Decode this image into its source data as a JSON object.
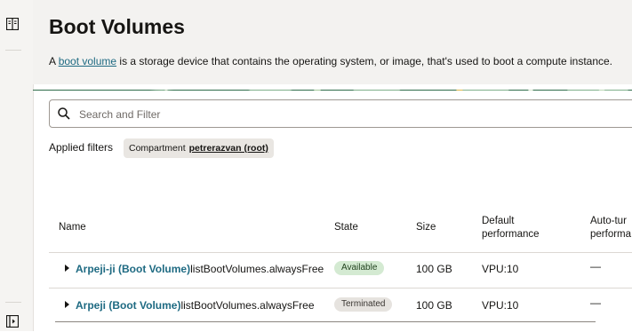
{
  "rail": {
    "top_icon": "panel-icon",
    "bottom_icon": "expand-panel-icon"
  },
  "page": {
    "title": "Boot Volumes",
    "desc_prefix": "A ",
    "desc_link": "boot volume",
    "desc_suffix": " is a storage device that contains the operating system, or image, that's used to boot a compute instance."
  },
  "search": {
    "placeholder": "Search and Filter",
    "value": ""
  },
  "filters": {
    "label": "Applied filters",
    "chip_key": "Compartment",
    "chip_value": "petrerazvan (root)"
  },
  "table": {
    "columns": {
      "name": "Name",
      "state": "State",
      "size": "Size",
      "default_perf_1": "Default",
      "default_perf_2": "performance",
      "autotune_1": "Auto-tur",
      "autotune_2": "performa"
    },
    "rows": [
      {
        "name_link": "Arpeji-ji (Boot Volume)",
        "name_suffix": "listBootVolumes.alwaysFree",
        "state": "Available",
        "size": "100 GB",
        "performance": "VPU:10",
        "autotune": "—"
      },
      {
        "name_link": "Arpeji (Boot Volume)",
        "name_suffix": "listBootVolumes.alwaysFree",
        "state": "Terminated",
        "size": "100 GB",
        "performance": "VPU:10",
        "autotune": "—"
      }
    ]
  },
  "colors": {
    "link": "#1e6a82",
    "available_badge": "#d4ead2",
    "terminated_badge": "#e6e3df",
    "banner_green": "#2f6b4a"
  }
}
